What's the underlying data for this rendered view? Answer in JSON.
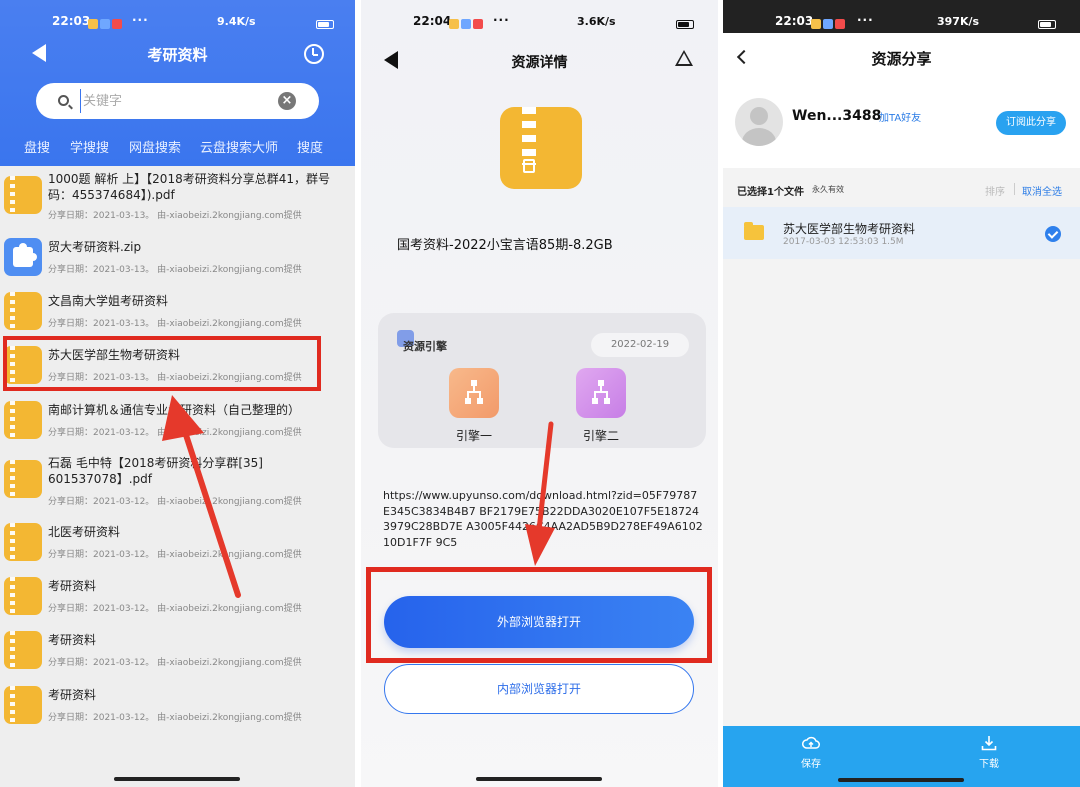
{
  "panel1": {
    "status": {
      "time": "22:03",
      "net": "9.4K/s"
    },
    "title": "考研资料",
    "search": {
      "placeholder": "关键字",
      "value": ""
    },
    "tabs": [
      "盘搜",
      "学搜搜",
      "网盘搜索",
      "云盘搜索大师",
      "搜度"
    ],
    "items": [
      {
        "title": "1000题 解析 上】【2018考研资料分享总群41，群号码：455374684】).pdf",
        "meta": "分享日期：2021-03-13。 由-xiaobeizi.2kongjiang.com提供"
      },
      {
        "title": "贸大考研资料.zip",
        "meta": "分享日期：2021-03-13。 由-xiaobeizi.2kongjiang.com提供"
      },
      {
        "title": "文昌南大学姐考研资料",
        "meta": "分享日期：2021-03-13。 由-xiaobeizi.2kongjiang.com提供"
      },
      {
        "title": "苏大医学部生物考研资料",
        "meta": "分享日期：2021-03-13。 由-xiaobeizi.2kongjiang.com提供"
      },
      {
        "title": "南邮计算机＆通信专业考研资料（自己整理的）",
        "meta": "分享日期：2021-03-12。 由-xiaobeizi.2kongjiang.com提供"
      },
      {
        "title": "石磊 毛中特【2018考研资料分享群[35] 601537078】.pdf",
        "meta": "分享日期：2021-03-12。 由-xiaobeizi.2kongjiang.com提供"
      },
      {
        "title": "北医考研资料",
        "meta": "分享日期：2021-03-12。 由-xiaobeizi.2kongjiang.com提供"
      },
      {
        "title": "考研资料",
        "meta": "分享日期：2021-03-12。 由-xiaobeizi.2kongjiang.com提供"
      },
      {
        "title": "考研资料",
        "meta": "分享日期：2021-03-12。 由-xiaobeizi.2kongjiang.com提供"
      },
      {
        "title": "考研资料",
        "meta": "分享日期：2021-03-12。 由-xiaobeizi.2kongjiang.com提供"
      }
    ]
  },
  "panel2": {
    "status": {
      "time": "22:04",
      "net": "3.6K/s"
    },
    "title": "资源详情",
    "resource_name": "国考资料-2022小宝言语85期-8.2GB",
    "engine_section": {
      "label": "资源引擎",
      "date": "2022-02-19",
      "engine1": "引擎一",
      "engine2": "引擎二"
    },
    "url": "https://www.upyunso.com/download.html?zid=05F79787E345C3834B4B7 BF2179E75B22DDA3020E107F5E187243979C28BD7E A3005F4426C4AA2AD5B9D278EF49A610210D1F7F 9C5",
    "btn_external": "外部浏览器打开",
    "btn_internal": "内部浏览器打开"
  },
  "panel3": {
    "status": {
      "time": "22:03",
      "net": "397K/s"
    },
    "title": "资源分享",
    "user_name": "Wen...3488",
    "add_friend": "加TA好友",
    "subscribe": "订阅此分享",
    "selected_count": "已选择1个文件",
    "validity": "永久有效",
    "sort": "排序",
    "cancel_all": "取消全选",
    "file": {
      "name": "苏大医学部生物考研资料",
      "meta": "2017-03-03  12:53:03  1.5M"
    },
    "save": "保存",
    "download": "下载"
  },
  "colors": {
    "accent_blue": "#3a75ee",
    "highlight_red": "#e02a1f",
    "file_yellow": "#f3b733",
    "bottom_bar": "#27a4ef"
  }
}
